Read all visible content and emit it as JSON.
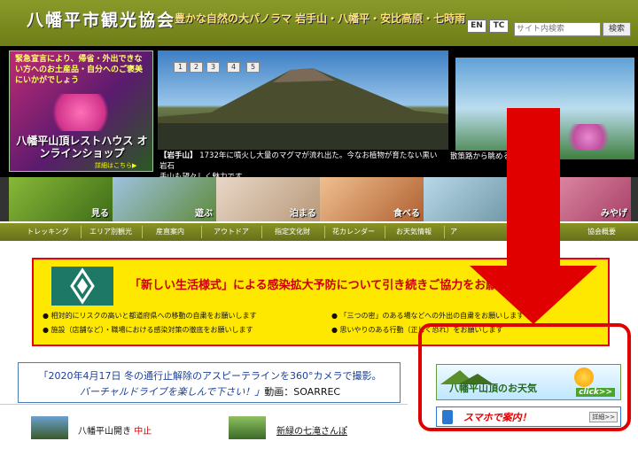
{
  "header": {
    "site_title": "八幡平市観光協会",
    "tagline": "豊かな自然の大パノラマ 岩手山・八幡平・安比高原・七時雨",
    "lang_en": "EN",
    "lang_tc": "TC",
    "search_placeholder": "サイト内検索",
    "search_button": "検索"
  },
  "promo": {
    "text": "緊急宣言により、帰省・外出できない方へのお土産品・自分へのご褒美にいかがでしょう",
    "title": "八幡平山頂レストハウス オンラインショップ",
    "detail": "詳細はこちら▶"
  },
  "slider": {
    "pages": [
      "1",
      "2",
      "3",
      "4",
      "5"
    ],
    "caption_title": "【岩手山】",
    "caption_text": "1732年に噴火し大量のマグマが流れ出た。今なお植物が育たない黒い岩石",
    "caption_text2": "手山も望々しく魅力です。",
    "caption_right": "散策路から眺める岩"
  },
  "categories": [
    {
      "label": "見る"
    },
    {
      "label": "遊ぶ"
    },
    {
      "label": "泊まる"
    },
    {
      "label": "食べる"
    },
    {
      "label": ""
    },
    {
      "label": "みやげ"
    }
  ],
  "nav": [
    "トレッキング",
    "エリア別観光",
    "産直案内",
    "アウトドア",
    "指定文化財",
    "花カレンダー",
    "お天気情報",
    "ア",
    "",
    "協会概要"
  ],
  "banner": {
    "title": "「新しい生活様式」による感染拡大予防について引き続きご協力をお願いします",
    "bullets": [
      "相対的にリスクの高いと都道府県への移動の自粛をお願いします",
      "「三つの密」のある場などへの外出の自粛をお願いします",
      "施設（店舗など）・職場における感染対策の徹底をお願いします",
      "思いやりのある行動（正しく恐れ）をお願いします"
    ]
  },
  "video": {
    "line1": "「2020年4月17日 冬の通行止解除のアスピーテラインを360°カメラで撮影。",
    "line2": "バーチャルドライブを楽しんで下さい！」",
    "credit": "動画：SOARREC"
  },
  "news": [
    {
      "title": "八幡平山開き",
      "status": "中止"
    },
    {
      "title": "新緑の七滝さんぽ"
    }
  ],
  "sidebar": {
    "weather_text": "八幡平山頂のお天気",
    "weather_click": "click>>",
    "mobile_text": "スマホで案内！",
    "mobile_detail": "詳細>>"
  },
  "colors": {
    "accent_red": "#e10000",
    "nav_green": "#7a8420",
    "banner_yellow": "#ffe800"
  }
}
